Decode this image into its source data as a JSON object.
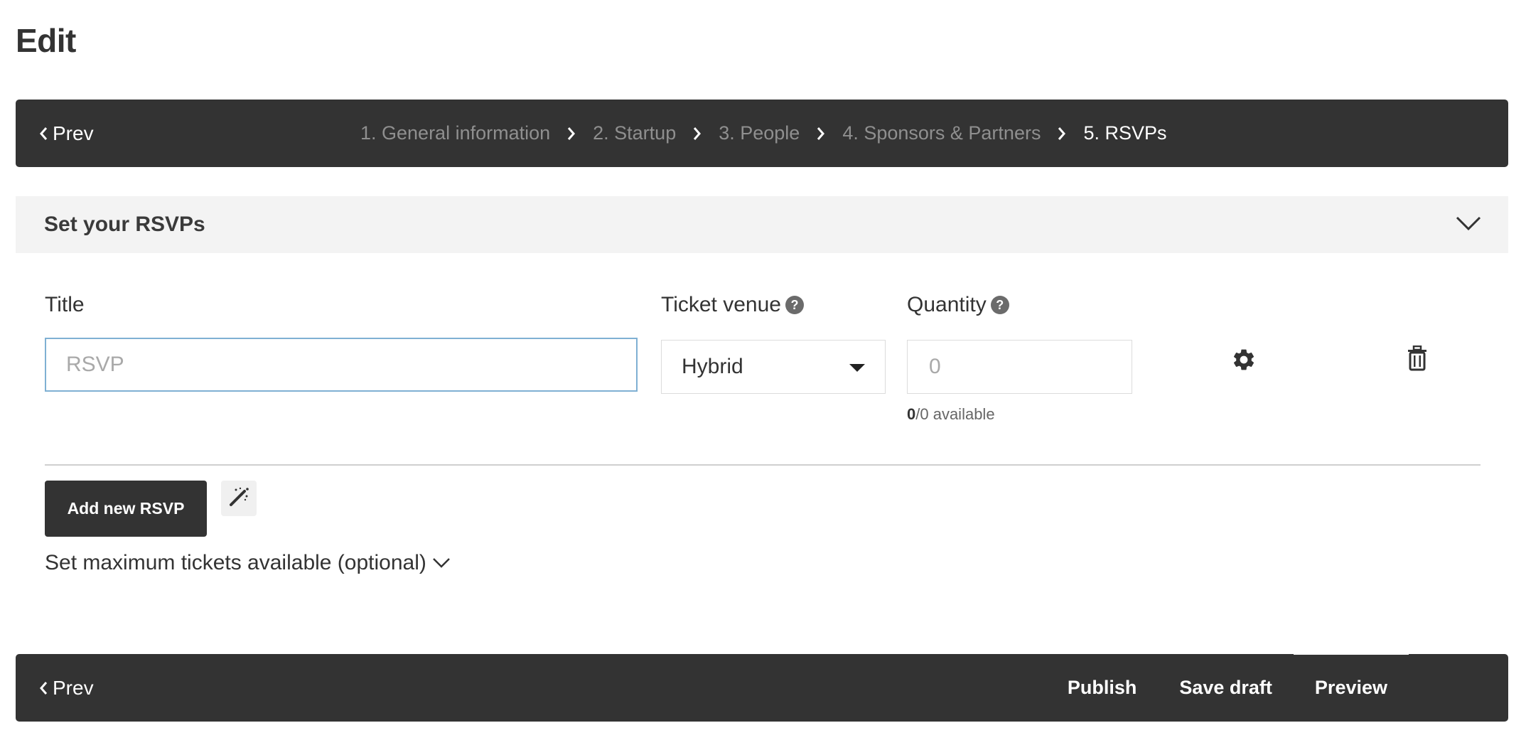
{
  "page": {
    "title": "Edit"
  },
  "stepper": {
    "prev_label": "Prev",
    "steps": [
      {
        "label": "1. General information",
        "active": false
      },
      {
        "label": "2. Startup",
        "active": false
      },
      {
        "label": "3. People",
        "active": false
      },
      {
        "label": "4. Sponsors & Partners",
        "active": false
      },
      {
        "label": "5. RSVPs",
        "active": true
      }
    ]
  },
  "section": {
    "title": "Set your RSVPs"
  },
  "form": {
    "title_label": "Title",
    "title_placeholder": "RSVP",
    "title_value": "",
    "venue_label": "Ticket venue",
    "venue_value": "Hybrid",
    "quantity_label": "Quantity",
    "quantity_placeholder": "0",
    "quantity_value": "",
    "available_count": "0",
    "available_rest": "/0 available",
    "help_glyph": "?"
  },
  "actions": {
    "add_rsvp_label": "Add new RSVP",
    "max_tickets_label": "Set maximum tickets available (optional)"
  },
  "bottom_bar": {
    "prev_label": "Prev",
    "publish_label": "Publish",
    "save_draft_label": "Save draft",
    "preview_label": "Preview"
  },
  "icons": {
    "settings": "gear-icon",
    "delete": "trash-icon",
    "magic": "magic-wand-icon",
    "collapse": "chevron-down-icon"
  },
  "colors": {
    "dark_bar": "#333333",
    "input_focus_border": "#7fb0d3",
    "section_bg": "#f3f3f3",
    "inactive_step": "#8f8f8f"
  }
}
